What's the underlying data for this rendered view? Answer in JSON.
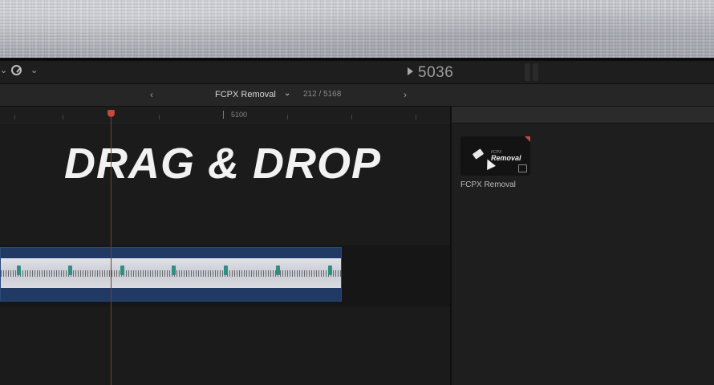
{
  "viewer": {
    "timecode": "5036"
  },
  "index_bar": {
    "project_name": "FCPX Removal",
    "clip_count": "212 / 5168"
  },
  "timeline": {
    "ruler_label": "5100",
    "headline": "DRAG & DROP"
  },
  "browser": {
    "item": {
      "thumb_subtitle": "FCPX",
      "thumb_title": "Removal",
      "label": "FCPX Removal"
    }
  },
  "icons": {
    "toolbar": [
      "chevron-down-icon",
      "speedometer-icon",
      "chevron-down-icon",
      "play-icon"
    ],
    "index_bar": [
      "chevron-left-icon",
      "chevron-down-icon",
      "chevron-right-icon"
    ],
    "browser": [
      "eraser-icon",
      "cursor-icon",
      "badge-icon"
    ]
  },
  "colors": {
    "clip": "#203a63",
    "marker": "#2f8f86",
    "playhead": "#c44a3a"
  }
}
